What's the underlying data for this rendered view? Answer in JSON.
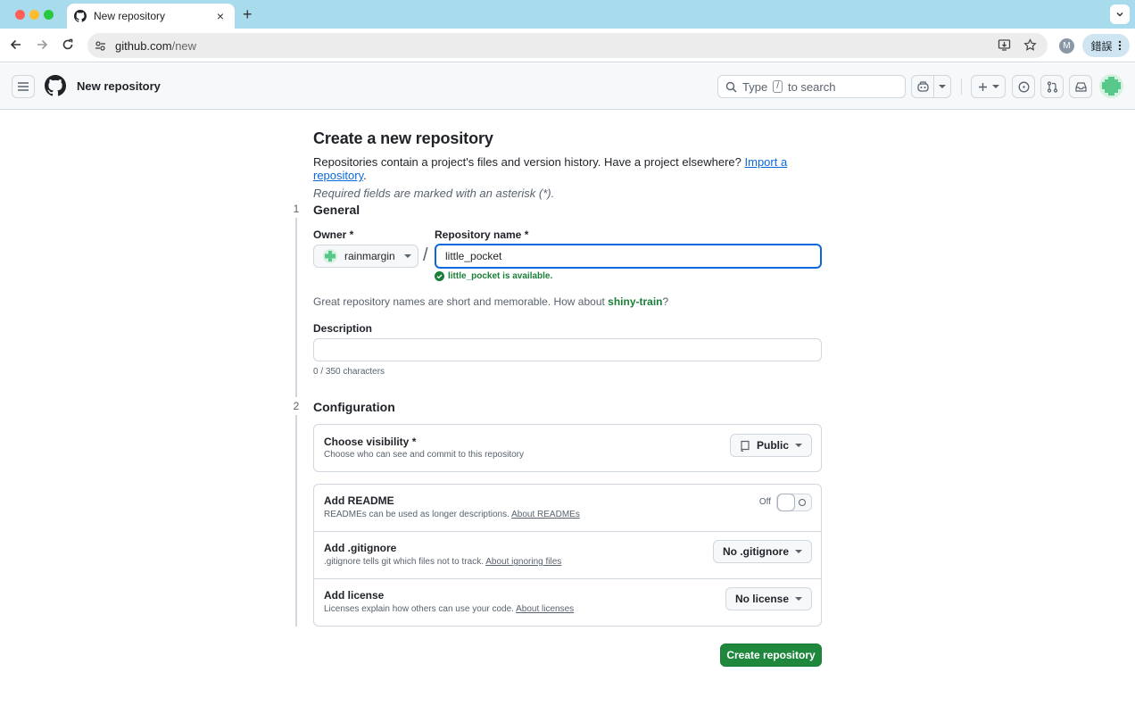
{
  "browser": {
    "tab_title": "New repository",
    "tab_close": "×",
    "new_tab": "+",
    "url_host": "github.com",
    "url_path": "/new",
    "profile_initial": "M",
    "lang_label": "錯誤"
  },
  "header": {
    "title": "New repository",
    "search_prefix": "Type",
    "search_key": "/",
    "search_suffix": "to search"
  },
  "page": {
    "heading": "Create a new repository",
    "intro": "Repositories contain a project's files and version history. Have a project elsewhere?",
    "import_link": "Import a repository",
    "intro_end": ".",
    "required_note": "Required fields are marked with an asterisk (*)."
  },
  "general": {
    "step": "1",
    "title": "General",
    "owner_label": "Owner *",
    "owner_value": "rainmargin",
    "slash": "/",
    "repo_label": "Repository name *",
    "repo_value": "little_pocket",
    "available_msg": "little_pocket is available.",
    "hint_prefix": "Great repository names are short and memorable. How about",
    "hint_suggestion": "shiny-train",
    "hint_suffix": "?",
    "description_label": "Description",
    "description_value": "",
    "char_count": "0 / 350 characters"
  },
  "configuration": {
    "step": "2",
    "title": "Configuration",
    "visibility_title": "Choose visibility *",
    "visibility_sub": "Choose who can see and commit to this repository",
    "visibility_value": "Public",
    "readme_title": "Add README",
    "readme_sub": "READMEs can be used as longer descriptions.",
    "readme_link": "About READMEs",
    "readme_state": "Off",
    "gitignore_title": "Add .gitignore",
    "gitignore_sub": ".gitignore tells git which files not to track.",
    "gitignore_link": "About ignoring files",
    "gitignore_value": "No .gitignore",
    "license_title": "Add license",
    "license_sub": "Licenses explain how others can use your code.",
    "license_link": "About licenses",
    "license_value": "No license"
  },
  "create_button": "Create repository",
  "colors": {
    "primary_green": "#1f883d",
    "link_blue": "#0969da",
    "success_green": "#1a7f37",
    "tab_strip": "#a8dced"
  }
}
